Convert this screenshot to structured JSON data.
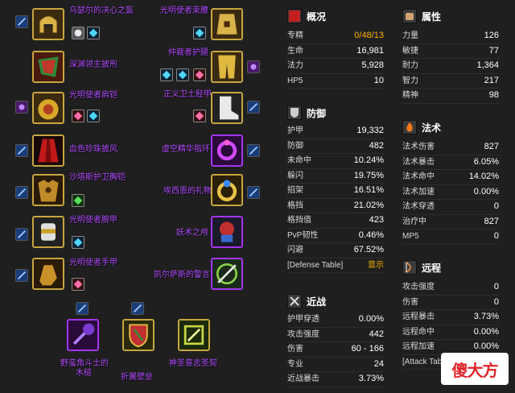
{
  "items_left": [
    {
      "name": "乌瑟尔的决心之盔",
      "gems": [
        "white",
        "cyan"
      ],
      "enchant": true
    },
    {
      "name": "深渊领主披刑",
      "gems": [],
      "enchant": false
    },
    {
      "name": "光明使者肩铠",
      "gems": [
        "pink",
        "cyan"
      ],
      "enchant": true
    },
    {
      "name": "血色珍珠披风",
      "gems": [],
      "enchant": true
    },
    {
      "name": "沙塔斯护卫胸铠",
      "gems": [
        "green"
      ],
      "enchant": true
    },
    {
      "name": "光明使者腕甲",
      "gems": [
        "cyan"
      ],
      "enchant": true
    },
    {
      "name": "光明使者手甲",
      "gems": [
        "pink"
      ],
      "enchant": false
    }
  ],
  "items_right": [
    {
      "name": "光明使者束腰",
      "gems": [
        "cyan"
      ],
      "enchant": false
    },
    {
      "name": "仲裁者护腿",
      "gems": [
        "cyan",
        "cyan",
        "pink"
      ],
      "enchant": false
    },
    {
      "name": "正义卫士胫甲",
      "gems": [
        "pink"
      ],
      "enchant": true
    },
    {
      "name": "虚空精华指环",
      "gems": [],
      "enchant": true
    },
    {
      "name": "埃西恩的礼物",
      "gems": [],
      "enchant": true
    },
    {
      "name": "妖术之颅",
      "gems": [],
      "enchant": false
    },
    {
      "name": "凯尔萨斯的警言",
      "gems": [],
      "enchant": false
    }
  ],
  "items_bottom": [
    {
      "name": "野蛮角斗士的\n木槌",
      "label1": "野蛮角斗士的",
      "label2": "木槌"
    },
    {
      "name": "折翼壁垒",
      "label1": "折翼壁垒",
      "label2": ""
    },
    {
      "name": "神圣意志圣契",
      "label1": "神圣意志圣契",
      "label2": ""
    }
  ],
  "panels": {
    "overview": {
      "title": "概况",
      "rows": [
        {
          "k": "专精",
          "v": "0/48/13"
        },
        {
          "k": "生命",
          "v": "16,981"
        },
        {
          "k": "法力",
          "v": "5,928"
        },
        {
          "k": "HP5",
          "v": "10"
        }
      ]
    },
    "defense": {
      "title": "防御",
      "rows": [
        {
          "k": "护甲",
          "v": "19,332"
        },
        {
          "k": "防御",
          "v": "482"
        },
        {
          "k": "未命中",
          "v": "10.24%"
        },
        {
          "k": "躲闪",
          "v": "19.75%"
        },
        {
          "k": "招架",
          "v": "16.51%"
        },
        {
          "k": "格挡",
          "v": "21.02%"
        },
        {
          "k": "格挡值",
          "v": "423"
        },
        {
          "k": "PvP韧性",
          "v": "0.46%"
        },
        {
          "k": "闪避",
          "v": "67.52%"
        },
        {
          "k": "[Defense Table]",
          "v": "显示"
        }
      ]
    },
    "melee": {
      "title": "近战",
      "rows": [
        {
          "k": "护甲穿透",
          "v": "0.00%"
        },
        {
          "k": "攻击强度",
          "v": "442"
        },
        {
          "k": "伤害",
          "v": "60 - 166"
        },
        {
          "k": "专业",
          "v": "24"
        },
        {
          "k": "近战暴击",
          "v": "3.73%"
        }
      ]
    },
    "attributes": {
      "title": "属性",
      "rows": [
        {
          "k": "力量",
          "v": "126"
        },
        {
          "k": "敏捷",
          "v": "77"
        },
        {
          "k": "耐力",
          "v": "1,364"
        },
        {
          "k": "智力",
          "v": "217"
        },
        {
          "k": "精神",
          "v": "98"
        }
      ]
    },
    "spell": {
      "title": "法术",
      "rows": [
        {
          "k": "法术伤害",
          "v": "827"
        },
        {
          "k": "法术暴击",
          "v": "6.05%"
        },
        {
          "k": "法术命中",
          "v": "14.02%"
        },
        {
          "k": "法术加速",
          "v": "0.00%"
        },
        {
          "k": "法术穿透",
          "v": "0"
        },
        {
          "k": "治疗中",
          "v": "827"
        },
        {
          "k": "MP5",
          "v": "0"
        }
      ]
    },
    "ranged": {
      "title": "远程",
      "rows": [
        {
          "k": "攻击强度",
          "v": "0"
        },
        {
          "k": "伤害",
          "v": "0"
        },
        {
          "k": "远程暴击",
          "v": "3.73%"
        },
        {
          "k": "远程命中",
          "v": "0.00%"
        },
        {
          "k": "远程加速",
          "v": "0.00%"
        },
        {
          "k": "[Attack Table]",
          "v": ""
        }
      ]
    }
  },
  "watermark": "傻大方",
  "colors": {
    "background": "#1f1f1f",
    "item_name": "#b24bff",
    "gold": "#ffb400",
    "legendary_border": "#c7a640"
  }
}
